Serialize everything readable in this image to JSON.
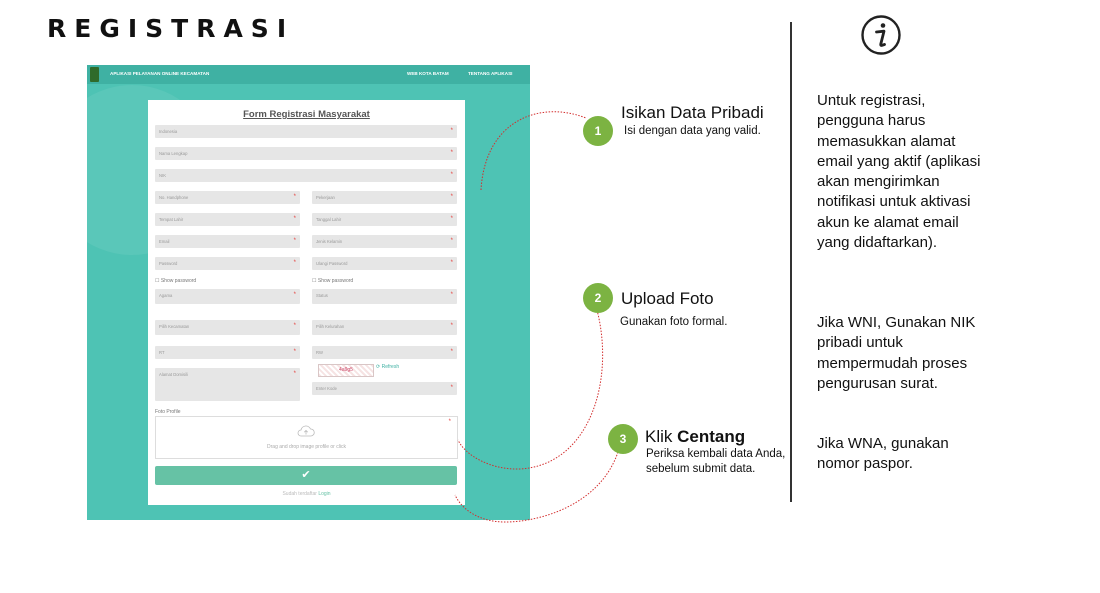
{
  "page": {
    "title": "REGISTRASI"
  },
  "screenshot": {
    "navbar": {
      "brand": "APLIKASI PELAYANAN ONLINE KECAMATAN",
      "links": [
        "WEB KOTA BATAM",
        "TENTANG APLIKASI"
      ]
    },
    "form": {
      "title": "Form Registrasi Masyarakat",
      "citizenship": "Indonesia",
      "full_name": "Nama Lengkap",
      "nik": "NIK",
      "phone": "No. Handphone",
      "job": "Pekerjaan",
      "birth_place": "Tempat Lahir",
      "birth_date": "Tanggal Lahir",
      "email": "Email",
      "gender": "Jenis Kelamin",
      "password": "Password",
      "password_confirm": "Ulangi Password",
      "show_password": "Show password",
      "religion": "Agama",
      "status": "Status",
      "district": "Pilih Kecamatan",
      "subdistrict": "Pilih Kelurahan",
      "rt": "RT",
      "rw": "RW",
      "address": "Alamat Domisili",
      "captcha_text": "4a9g5",
      "refresh": "Refresh",
      "captcha_input": "Enter Kode",
      "photo_label": "Foto Profile",
      "dropzone_text": "Drag and drop image profile or click",
      "submit_symbol": "✔",
      "login_prompt": "Sudah terdaftar",
      "login_link": "Login"
    }
  },
  "steps": [
    {
      "number": "1",
      "title": "Isikan Data Pribadi",
      "title_bold": "",
      "desc": "Isi dengan data yang valid."
    },
    {
      "number": "2",
      "title": "Upload Foto",
      "title_bold": "",
      "desc": "Gunakan foto formal."
    },
    {
      "number": "3",
      "title": "Klik ",
      "title_bold": "Centang",
      "desc": "Periksa kembali data Anda, sebelum submit data."
    }
  ],
  "info": {
    "icon": "info-icon",
    "paragraphs": [
      "Untuk registrasi, pengguna harus memasukkan alamat email yang aktif (aplikasi akan mengirimkan notifikasi untuk aktivasi akun ke alamat email yang didaftarkan).",
      "Jika WNI, Gunakan NIK pribadi untuk mempermudah proses pengurusan surat.",
      "Jika WNA, gunakan nomor paspor."
    ]
  },
  "colors": {
    "teal": "#4ec3b4",
    "step_green": "#7cb342",
    "submit_green": "#66c2a5",
    "curve_red": "#d32f2f"
  }
}
